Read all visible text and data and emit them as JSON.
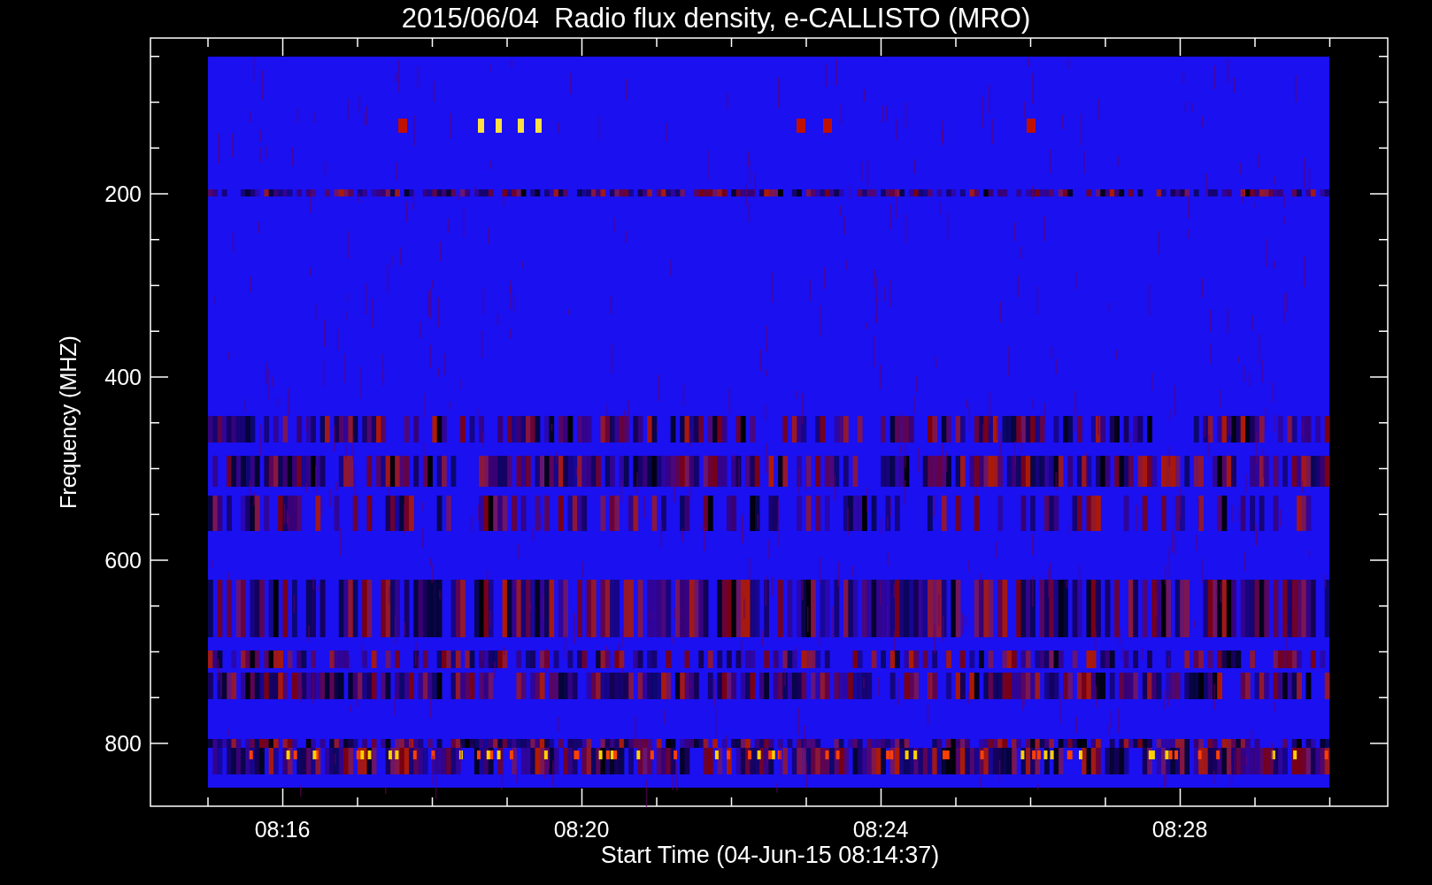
{
  "title": "2015/06/04  Radio flux density, e-CALLISTO (MRO)",
  "y_axis": {
    "label": "Frequency (MHZ)",
    "ticks": [
      "200",
      "400",
      "600",
      "800"
    ]
  },
  "x_axis": {
    "label": "Start Time (04-Jun-15 08:14:37)",
    "ticks": [
      "08:16",
      "08:20",
      "08:24",
      "08:28"
    ]
  }
}
